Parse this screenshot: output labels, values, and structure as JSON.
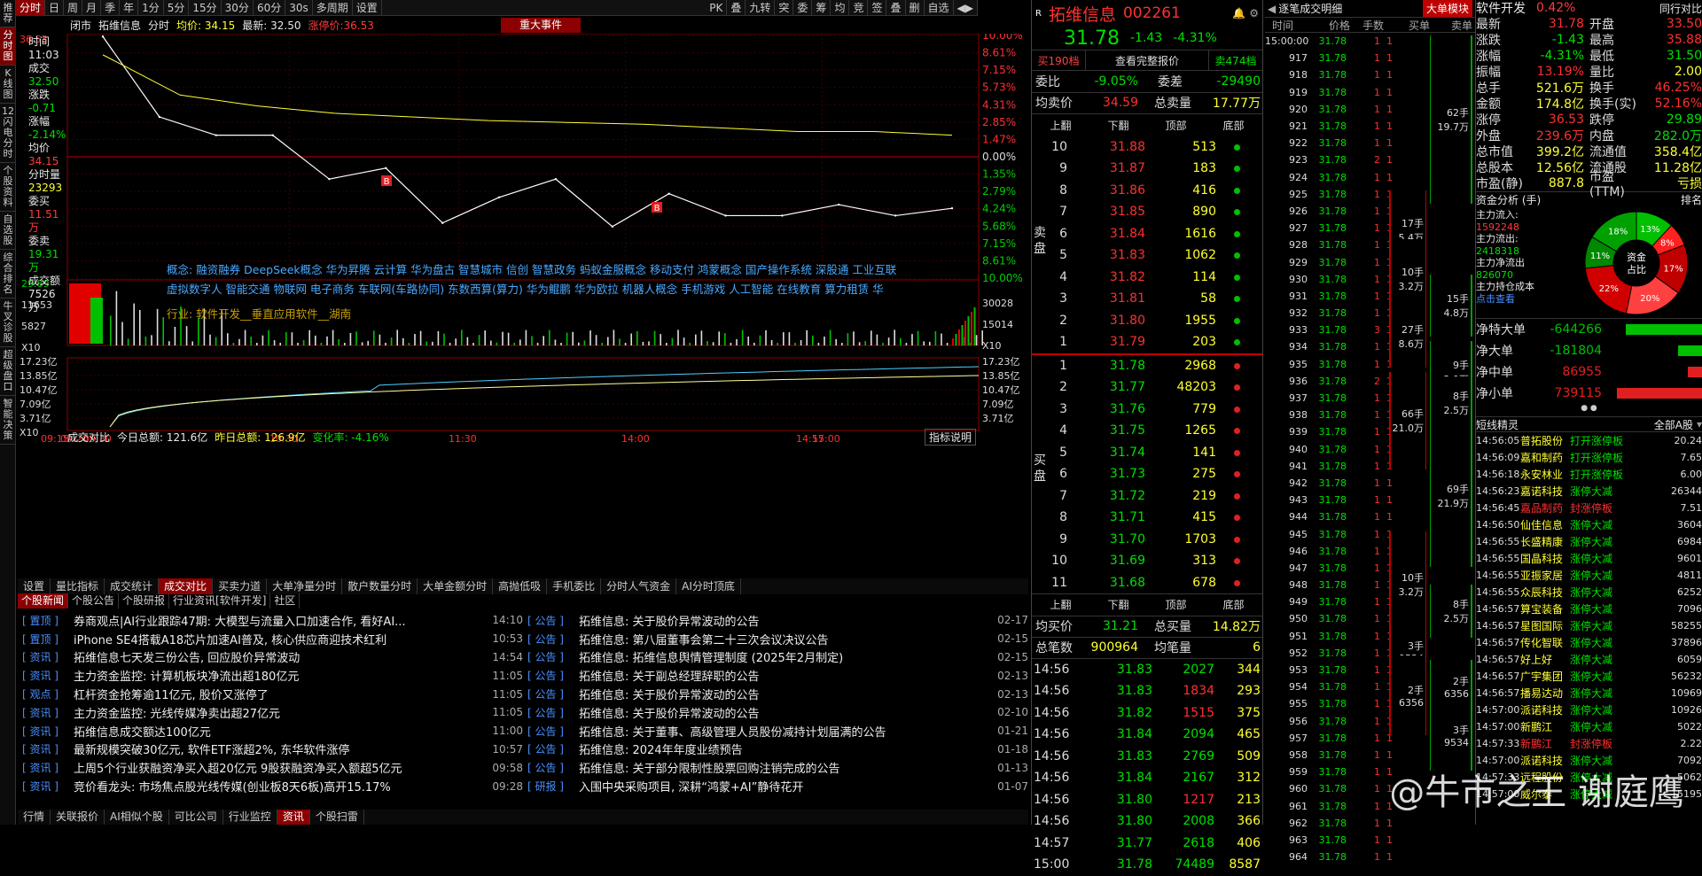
{
  "left_nav": [
    "推荐",
    "分时图",
    "K线图",
    "12闪电分时",
    "个股资料",
    "自选股",
    "综合排名",
    "牛叉诊股",
    "超级盘口",
    "智能决策"
  ],
  "topbar": {
    "items": [
      "分时",
      "日",
      "周",
      "月",
      "季",
      "年",
      "1分",
      "5分",
      "15分",
      "30分",
      "60分",
      "30s",
      "多周期",
      "设置"
    ],
    "right": [
      "PK",
      "叠",
      "九转",
      "突",
      "委",
      "筹",
      "均",
      "竞",
      "签",
      "叠",
      "删",
      "自选",
      "◀▶"
    ]
  },
  "infobar": {
    "items": [
      "闭市",
      "拓维信息",
      "分时",
      "均价: 34.15",
      "最新: 32.50",
      "涨停价:36.53"
    ],
    "event": "重大事件"
  },
  "sidebox": {
    "time_label": "时间",
    "time": "11:03",
    "vol_label": "成交",
    "vol": "32.50",
    "chg_label": "涨跌",
    "chg": "-0.71",
    "pct_label": "涨幅",
    "pct": "-2.14%",
    "avg_label": "均价",
    "avg": "34.15",
    "qty_label": "分时量",
    "qty": "23293",
    "buy_label": "委买",
    "buy": "11.51万",
    "sell_label": "委卖",
    "sell": "19.31万",
    "amt_label": "成交额",
    "amt": "7526万"
  },
  "price_axis": {
    "left": [
      "36.53",
      "",
      "",
      "",
      "",
      "",
      "",
      "",
      "",
      "",
      "",
      "",
      "",
      "",
      ""
    ],
    "right_pct": [
      "10.00%",
      "8.61%",
      "7.15%",
      "5.73%",
      "4.31%",
      "2.85%",
      "1.47%",
      "0.00%",
      "1.35%",
      "2.79%",
      "4.24%",
      "5.68%",
      "7.15%",
      "8.61%",
      "10.00%"
    ],
    "vol_left": [
      "29.89",
      "11653",
      "5827",
      "X10"
    ],
    "vol_right": [
      "30028",
      "15014",
      "X10"
    ],
    "amt_left": [
      "17.23亿",
      "13.85亿",
      "10.47亿",
      "7.09亿",
      "3.71亿",
      "X10"
    ],
    "amt_right": [
      "17.23亿",
      "13.85亿",
      "10.47亿",
      "7.09亿",
      "3.71亿"
    ]
  },
  "concepts": {
    "line1": "概念: 融资融券 DeepSeek概念 华为昇腾 云计算 华为盘古 智慧城市 信创 智慧政务 蚂蚁金服概念 移动支付 鸿蒙概念 国产操作系统 深股通 工业互联",
    "line2": "虚拟数字人 智能交通 物联网 电子商务 车联网(车路协同) 东数西算(算力) 华为鲲鹏 华为欧拉 机器人概念 手机游戏 人工智能 在线教育 算力租赁 华",
    "industry": "行业: 软件开发__垂直应用软件__湖南"
  },
  "amount_bar": {
    "title": "成交对比",
    "today": "今日总额: 121.6亿",
    "yest": "昨日总额: 126.9亿",
    "change": "变化率: -4.16%",
    "explain": "指标说明"
  },
  "time_axis": [
    "09:15",
    "09:20",
    "09:30",
    "10:30",
    "11:30",
    "14:00",
    "14:57",
    "15:00"
  ],
  "bottom_tabs": [
    "设置",
    "量比指标",
    "成交统计",
    "成交对比",
    "买卖力道",
    "大单净量分时",
    "散户数量分时",
    "大单金额分时",
    "高抛低吸",
    "手机委比",
    "分时人气资金",
    "AI分时顶底"
  ],
  "news_tabs": [
    "个股新闻",
    "个股公告",
    "个股研报",
    "行业资讯[软件开发]",
    "社区"
  ],
  "news_left": [
    {
      "tag": "[ 置顶 ]",
      "t": "券商观点|AI行业跟踪47期: 大模型与流量入口加速合作, 看好AI...",
      "tm": "14:10"
    },
    {
      "tag": "[ 置顶 ]",
      "t": "iPhone SE4搭载A18芯片加速AI普及, 核心供应商迎技术红利",
      "tm": "10:53"
    },
    {
      "tag": "[ 资讯 ]",
      "t": "拓维信息七天发三份公告, 回应股价异常波动",
      "tm": "14:54"
    },
    {
      "tag": "[ 资讯 ]",
      "t": "主力资金监控: 计算机板块净流出超180亿元",
      "tm": "11:05"
    },
    {
      "tag": "[ 观点 ]",
      "t": "杠杆资金抢筹逾11亿元, 股价又涨停了",
      "tm": "11:05"
    },
    {
      "tag": "[ 资讯 ]",
      "t": "主力资金监控: 光线传媒净卖出超27亿元",
      "tm": "11:05"
    },
    {
      "tag": "[ 资讯 ]",
      "t": "拓维信息成交额达100亿元",
      "tm": "11:00"
    },
    {
      "tag": "[ 资讯 ]",
      "t": "最新规模突破30亿元, 软件ETF涨超2%, 东华软件涨停",
      "tm": "10:57"
    },
    {
      "tag": "[ 资讯 ]",
      "t": "上周5个行业获融资净买入超20亿元 9股获融资净买入额超5亿元",
      "tm": "09:58"
    },
    {
      "tag": "[ 资讯 ]",
      "t": "竞价看龙头: 市场焦点股光线传媒(创业板8天6板)高开15.17%",
      "tm": "09:28"
    }
  ],
  "news_right": [
    {
      "tag": "[ 公告 ]",
      "t": "拓维信息: 关于股价异常波动的公告",
      "tm": "02-17"
    },
    {
      "tag": "[ 公告 ]",
      "t": "拓维信息: 第八届董事会第二十三次会议决议公告",
      "tm": "02-15"
    },
    {
      "tag": "[ 公告 ]",
      "t": "拓维信息: 拓维信息舆情管理制度 (2025年2月制定)",
      "tm": "02-15"
    },
    {
      "tag": "[ 公告 ]",
      "t": "拓维信息: 关于副总经理辞职的公告",
      "tm": "02-13"
    },
    {
      "tag": "[ 公告 ]",
      "t": "拓维信息: 关于股价异常波动的公告",
      "tm": "02-13"
    },
    {
      "tag": "[ 公告 ]",
      "t": "拓维信息: 关于股价异常波动的公告",
      "tm": "02-10"
    },
    {
      "tag": "[ 公告 ]",
      "t": "拓维信息: 关于董事、高级管理人员股份减持计划届满的公告",
      "tm": "01-21"
    },
    {
      "tag": "[ 公告 ]",
      "t": "拓维信息: 2024年年度业绩预告",
      "tm": "01-18"
    },
    {
      "tag": "[ 公告 ]",
      "t": "拓维信息: 关于部分限制性股票回购注销完成的公告",
      "tm": "01-13"
    },
    {
      "tag": "[ 研报 ]",
      "t": "入围中央采购项目, 深耕“鸿蒙+AI”静待花开",
      "tm": "01-07"
    }
  ],
  "footer": [
    "行情",
    "关联报价",
    "AI相似个股",
    "可比公司",
    "行业监控",
    "资讯",
    "个股扫雷"
  ],
  "quote": {
    "name": "拓维信息",
    "code": "002261",
    "price": "31.78",
    "chg": "-1.43",
    "pct": "-4.31%",
    "buy_btn": "买190档",
    "full_btn": "查看完整报价",
    "sell_btn": "卖474档",
    "webi_l": "委比",
    "webi": "-9.05%",
    "weicha_l": "委差",
    "weicha": "-29490",
    "avg_sell_l": "均卖价",
    "avg_sell": "34.59",
    "tot_sell_l": "总卖量",
    "tot_sell": "17.77万",
    "hdr": [
      "上翻",
      "下翻",
      "顶部",
      "底部"
    ],
    "sell_label": "卖盘",
    "buy_label": "买盘",
    "sells": [
      [
        "10",
        "31.88",
        "513"
      ],
      [
        "9",
        "31.87",
        "183"
      ],
      [
        "8",
        "31.86",
        "416"
      ],
      [
        "7",
        "31.85",
        "890"
      ],
      [
        "6",
        "31.84",
        "1616"
      ],
      [
        "5",
        "31.83",
        "1062"
      ],
      [
        "4",
        "31.82",
        "114"
      ],
      [
        "3",
        "31.81",
        "58"
      ],
      [
        "2",
        "31.80",
        "1955"
      ],
      [
        "1",
        "31.79",
        "203"
      ]
    ],
    "buys": [
      [
        "1",
        "31.78",
        "2968"
      ],
      [
        "2",
        "31.77",
        "48203"
      ],
      [
        "3",
        "31.76",
        "779"
      ],
      [
        "4",
        "31.75",
        "1265"
      ],
      [
        "5",
        "31.74",
        "141"
      ],
      [
        "6",
        "31.73",
        "275"
      ],
      [
        "7",
        "31.72",
        "219"
      ],
      [
        "8",
        "31.71",
        "415"
      ],
      [
        "9",
        "31.70",
        "1703"
      ],
      [
        "10",
        "31.69",
        "313"
      ],
      [
        "11",
        "31.68",
        "678"
      ]
    ],
    "avg_buy_l": "均买价",
    "avg_buy": "31.21",
    "tot_buy_l": "总买量",
    "tot_buy": "14.82万",
    "tot_cnt_l": "总笔数",
    "tot_cnt": "900964",
    "avg_cnt_l": "均笔量",
    "avg_cnt": "6",
    "trades": [
      [
        "14:56",
        "31.83",
        "2027",
        "344"
      ],
      [
        "14:56",
        "31.83",
        "1834",
        "293"
      ],
      [
        "14:56",
        "31.82",
        "1515",
        "375"
      ],
      [
        "14:56",
        "31.84",
        "2094",
        "465"
      ],
      [
        "14:56",
        "31.83",
        "2769",
        "509"
      ],
      [
        "14:56",
        "31.84",
        "2167",
        "312"
      ],
      [
        "14:56",
        "31.80",
        "1217",
        "213"
      ],
      [
        "14:56",
        "31.80",
        "2008",
        "366"
      ],
      [
        "14:57",
        "31.77",
        "2618",
        "406"
      ],
      [
        "15:00",
        "31.78",
        "74489",
        "8587"
      ]
    ]
  },
  "ticks": {
    "title": "逐笔成交明细",
    "big_btn": "大单模块",
    "hdr": [
      "时间",
      "价格",
      "手数",
      "买单",
      "卖单"
    ],
    "rows": [
      [
        "15:00:00",
        "31.78",
        "1",
        "1"
      ],
      [
        "917",
        "31.78",
        "1",
        "1"
      ],
      [
        "918",
        "31.78",
        "1",
        "1"
      ],
      [
        "919",
        "31.78",
        "1",
        "1"
      ],
      [
        "920",
        "31.78",
        "1",
        "1"
      ],
      [
        "921",
        "31.78",
        "1",
        "1"
      ],
      [
        "922",
        "31.78",
        "1",
        "1"
      ],
      [
        "923",
        "31.78",
        "2",
        "1"
      ],
      [
        "924",
        "31.78",
        "1",
        "1"
      ],
      [
        "925",
        "31.78",
        "1",
        "1"
      ],
      [
        "926",
        "31.78",
        "1",
        "1"
      ],
      [
        "927",
        "31.78",
        "1",
        "1"
      ],
      [
        "928",
        "31.78",
        "1",
        "1"
      ],
      [
        "929",
        "31.78",
        "1",
        "1"
      ],
      [
        "930",
        "31.78",
        "1",
        "1"
      ],
      [
        "931",
        "31.78",
        "1",
        "1"
      ],
      [
        "932",
        "31.78",
        "1",
        "1"
      ],
      [
        "933",
        "31.78",
        "3",
        "1"
      ],
      [
        "934",
        "31.78",
        "1",
        "1"
      ],
      [
        "935",
        "31.78",
        "1",
        "1"
      ],
      [
        "936",
        "31.78",
        "2",
        "1"
      ],
      [
        "937",
        "31.78",
        "1",
        "1"
      ],
      [
        "938",
        "31.78",
        "1",
        "1"
      ],
      [
        "939",
        "31.78",
        "1",
        "1"
      ],
      [
        "940",
        "31.78",
        "1",
        "1"
      ],
      [
        "941",
        "31.78",
        "1",
        "1"
      ],
      [
        "942",
        "31.78",
        "1",
        "1"
      ],
      [
        "943",
        "31.78",
        "1",
        "1"
      ],
      [
        "944",
        "31.78",
        "1",
        "1"
      ],
      [
        "945",
        "31.78",
        "1",
        "1"
      ],
      [
        "946",
        "31.78",
        "1",
        "1"
      ],
      [
        "947",
        "31.78",
        "1",
        "1"
      ],
      [
        "948",
        "31.78",
        "1",
        "1"
      ],
      [
        "949",
        "31.78",
        "1",
        "1"
      ],
      [
        "950",
        "31.78",
        "1",
        "1"
      ],
      [
        "951",
        "31.78",
        "1",
        "1"
      ],
      [
        "952",
        "31.78",
        "1",
        "1"
      ],
      [
        "953",
        "31.78",
        "1",
        "1"
      ],
      [
        "954",
        "31.78",
        "1",
        "1"
      ],
      [
        "955",
        "31.78",
        "1",
        "1"
      ],
      [
        "956",
        "31.78",
        "1",
        "1"
      ],
      [
        "957",
        "31.78",
        "1",
        "1"
      ],
      [
        "958",
        "31.78",
        "1",
        "1"
      ],
      [
        "959",
        "31.78",
        "1",
        "1"
      ],
      [
        "960",
        "31.78",
        "1",
        "1"
      ],
      [
        "961",
        "31.78",
        "1",
        "1"
      ],
      [
        "962",
        "31.78",
        "1",
        "1"
      ],
      [
        "963",
        "31.78",
        "1",
        "1"
      ],
      [
        "964",
        "31.78",
        "1",
        "1"
      ]
    ],
    "blocks_buy": [
      {
        "v": "17手",
        "p": "5.4万"
      },
      {
        "v": "10手",
        "p": "3.2万"
      },
      {
        "v": "27手",
        "p": "8.6万"
      },
      {
        "v": "66手",
        "p": "21.0万"
      },
      {
        "v": "10手",
        "p": "3.2万"
      },
      {
        "v": "3手",
        "p": "9534"
      },
      {
        "v": "2手",
        "p": "6356"
      }
    ],
    "blocks_sell": [
      {
        "v": "62手",
        "p": "19.7万"
      },
      {
        "v": "15手",
        "p": "4.8万"
      },
      {
        "v": "9手",
        "p": "2.9万"
      },
      {
        "v": "8手",
        "p": "2.5万"
      },
      {
        "v": "69手",
        "p": "21.9万"
      },
      {
        "v": "8手",
        "p": "2.5万"
      },
      {
        "v": "2手",
        "p": "6356"
      },
      {
        "v": "3手",
        "p": "9534"
      }
    ]
  },
  "right": {
    "title": "软件开发",
    "pct": "0.42%",
    "top": "同行对比",
    "kv": [
      [
        "最新",
        "31.78",
        "开盘",
        "33.50"
      ],
      [
        "涨跌",
        "-1.43",
        "最高",
        "35.88"
      ],
      [
        "涨幅",
        "-4.31%",
        "最低",
        "31.50"
      ],
      [
        "振幅",
        "13.19%",
        "量比",
        "2.00"
      ],
      [
        "总手",
        "521.6万",
        "换手",
        "46.25%"
      ],
      [
        "金额",
        "174.8亿",
        "换手(实)",
        "52.16%"
      ],
      [
        "涨停",
        "36.53",
        "跌停",
        "29.89"
      ],
      [
        "外盘",
        "239.6万",
        "内盘",
        "282.0万"
      ],
      [
        "总市值",
        "399.2亿",
        "流通值",
        "358.4亿"
      ],
      [
        "总股本",
        "12.56亿",
        "流通股",
        "11.28亿"
      ],
      [
        "市盈(静)",
        "887.8",
        "市盈(TTM)",
        "亏损"
      ]
    ],
    "fund_title": "资金分析 (手)",
    "fund_rank": "排名",
    "main_in_l": "主力流入:",
    "main_in": "1592248",
    "main_out_l": "主力流出:",
    "main_out": "2418318",
    "main_net_l": "主力净流出",
    "main_net": "826070",
    "main_cost": "主力持仓成本",
    "main_cost_link": "点击查看",
    "donut": {
      "center": "资金占比",
      "slices": [
        {
          "v": "13%",
          "c": "#00c000"
        },
        {
          "v": "8%",
          "c": "#ff2020"
        },
        {
          "v": "17%",
          "c": "#c00000"
        },
        {
          "v": "20%",
          "c": "#ff4040"
        },
        {
          "v": "22%",
          "c": "#d00000"
        },
        {
          "v": "11%",
          "c": "#008800"
        },
        {
          "v": "18%",
          "c": "#00a000"
        }
      ]
    },
    "nets": [
      {
        "l": "净特大单",
        "v": "-644266",
        "c": "#00c000",
        "w": 0.8
      },
      {
        "l": "净大单",
        "v": "-181804",
        "c": "#00c000",
        "w": 0.25
      },
      {
        "l": "净中单",
        "v": "86955",
        "c": "#e02020",
        "w": 0.15
      },
      {
        "l": "净小单",
        "v": "739115",
        "c": "#e02020",
        "w": 0.9
      }
    ],
    "radar_title": "短线精灵",
    "radar_filter": "全部A股",
    "radar": [
      [
        "14:56:05",
        "普拓股份",
        "打开涨停板",
        "20.24"
      ],
      [
        "14:56:09",
        "嘉和制药",
        "打开涨停板",
        "7.65"
      ],
      [
        "14:56:18",
        "永安林业",
        "打开涨停板",
        "6.00"
      ],
      [
        "14:56:23",
        "嘉诺科技",
        "涨停大减",
        "26344"
      ],
      [
        "14:56:45",
        "嘉品制药",
        "封涨停板",
        "7.51"
      ],
      [
        "14:56:50",
        "仙佳信息",
        "涨停大减",
        "3604"
      ],
      [
        "14:56:55",
        "长盛精康",
        "涨停大减",
        "6984"
      ],
      [
        "14:56:55",
        "国晶科技",
        "涨停大减",
        "9601"
      ],
      [
        "14:56:55",
        "亚振家居",
        "涨停大减",
        "4811"
      ],
      [
        "14:56:55",
        "众辰科技",
        "涨停大减",
        "6252"
      ],
      [
        "14:56:57",
        "算宝装备",
        "涨停大减",
        "7096"
      ],
      [
        "14:56:57",
        "星图国际",
        "涨停大减",
        "58255"
      ],
      [
        "14:56:57",
        "传化智联",
        "涨停大减",
        "37896"
      ],
      [
        "14:56:57",
        "好上好",
        "涨停大减",
        "6059"
      ],
      [
        "14:56:57",
        "广宇集团",
        "涨停大减",
        "56232"
      ],
      [
        "14:56:57",
        "播易达动",
        "涨停大减",
        "10969"
      ],
      [
        "14:57:00",
        "派诺科技",
        "涨停大减",
        "10926"
      ],
      [
        "14:57:00",
        "新鹏江",
        "涨停大减",
        "5022"
      ],
      [
        "14:57:33",
        "新鹏江",
        "封涨停板",
        "2.22"
      ],
      [
        "14:57:00",
        "派诺科技",
        "涨停大减",
        "7092"
      ],
      [
        "14:57:33",
        "远程股份",
        "涨停大减",
        "5062"
      ],
      [
        "14:57:00",
        "威尔泰",
        "涨停大减",
        "15195"
      ]
    ]
  },
  "watermark": "@牛市之王 谢庭鹰",
  "chart_data": {
    "type": "line",
    "x": [
      "09:30",
      "10:30",
      "11:30",
      "14:00",
      "15:00"
    ],
    "price": [
      36.5,
      34.3,
      33.8,
      33.8,
      32.6,
      32.9,
      31.4,
      32.1,
      32.6,
      31.3,
      32.2,
      31.6,
      31.6,
      31.9,
      31.6,
      31.8
    ],
    "avg": [
      36.0,
      34.9,
      34.6,
      34.4,
      34.3,
      34.2,
      34.15,
      34.1,
      34.0,
      33.9,
      33.9,
      33.8
    ],
    "ylim": [
      29.89,
      36.53
    ],
    "prev_close": "33.21"
  }
}
